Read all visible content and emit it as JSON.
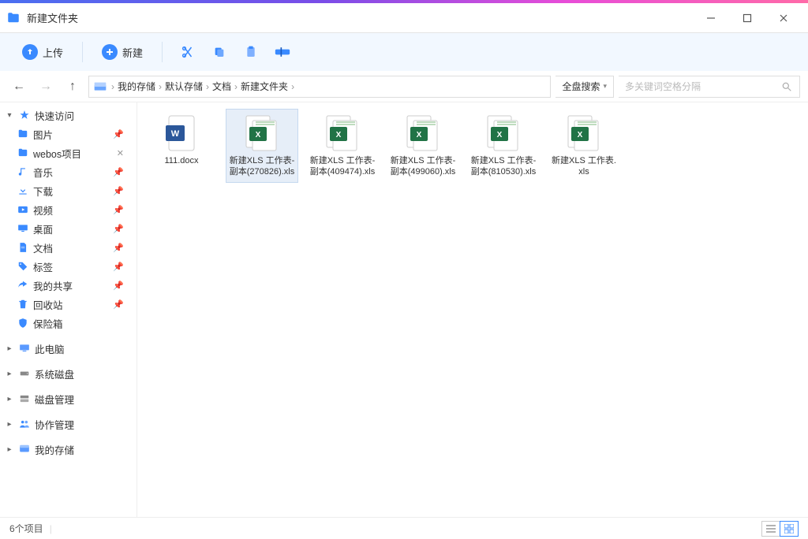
{
  "window": {
    "title": "新建文件夹"
  },
  "toolbar": {
    "upload_label": "上传",
    "new_label": "新建"
  },
  "breadcrumbs": [
    "我的存储",
    "默认存储",
    "文档",
    "新建文件夹"
  ],
  "search": {
    "scope_label": "全盘搜索",
    "placeholder": "多关键词空格分隔"
  },
  "sidebar": {
    "quick_access": {
      "label": "快速访问",
      "expanded": true
    },
    "items": [
      {
        "label": "图片",
        "icon": "folder",
        "pinned": true
      },
      {
        "label": "webos项目",
        "icon": "folder",
        "pinned": true,
        "close": true
      },
      {
        "label": "音乐",
        "icon": "music",
        "pinned": true
      },
      {
        "label": "下载",
        "icon": "download",
        "pinned": true
      },
      {
        "label": "视频",
        "icon": "video",
        "pinned": true
      },
      {
        "label": "桌面",
        "icon": "desktop",
        "pinned": true
      },
      {
        "label": "文档",
        "icon": "document",
        "pinned": true
      },
      {
        "label": "标签",
        "icon": "tag",
        "pinned": true
      },
      {
        "label": "我的共享",
        "icon": "share",
        "pinned": true
      },
      {
        "label": "回收站",
        "icon": "trash",
        "pinned": true
      }
    ],
    "vault": {
      "label": "保险箱"
    },
    "groups": [
      {
        "label": "此电脑",
        "icon": "pc"
      },
      {
        "label": "系统磁盘",
        "icon": "disk"
      },
      {
        "label": "磁盘管理",
        "icon": "diskmgr"
      },
      {
        "label": "协作管理",
        "icon": "collab"
      },
      {
        "label": "我的存储",
        "icon": "storage"
      }
    ]
  },
  "files": [
    {
      "name": "111.docx",
      "type": "docx",
      "selected": false
    },
    {
      "name": "新建XLS 工作表-副本(270826).xls",
      "type": "xls",
      "selected": true
    },
    {
      "name": "新建XLS 工作表-副本(409474).xls",
      "type": "xls",
      "selected": false
    },
    {
      "name": "新建XLS 工作表-副本(499060).xls",
      "type": "xls",
      "selected": false
    },
    {
      "name": "新建XLS 工作表-副本(810530).xls",
      "type": "xls",
      "selected": false
    },
    {
      "name": "新建XLS 工作表.xls",
      "type": "xls",
      "selected": false
    }
  ],
  "status": {
    "count_label": "6个项目"
  },
  "icons": {
    "scissors": "cut-icon",
    "copy": "copy-icon",
    "paste": "paste-icon",
    "rename": "rename-icon"
  },
  "colors": {
    "accent": "#3a8aff",
    "toolbar_bg": "#f2f8ff"
  }
}
